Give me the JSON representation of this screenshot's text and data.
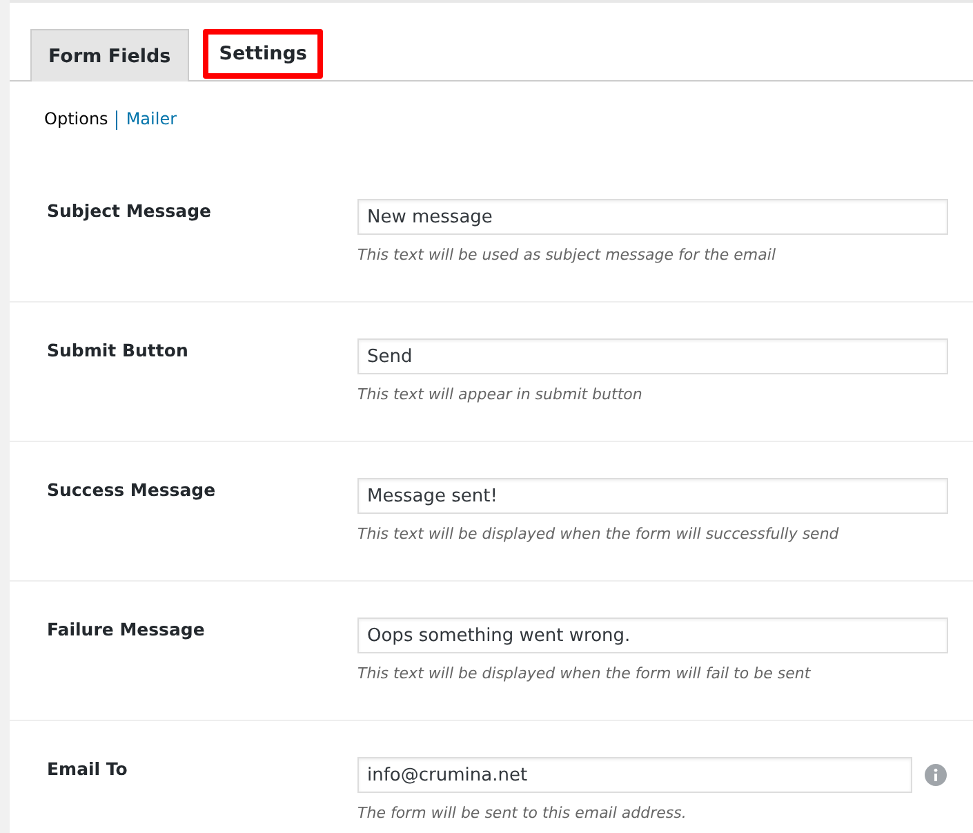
{
  "tabs": [
    {
      "label": "Form Fields",
      "selected": false,
      "highlighted": false
    },
    {
      "label": "Settings",
      "selected": true,
      "highlighted": true
    }
  ],
  "subnav": [
    {
      "label": "Options",
      "selected": true
    },
    {
      "label": "Mailer",
      "selected": false
    }
  ],
  "fields": [
    {
      "label": "Subject Message",
      "value": "New message",
      "help": "This text will be used as subject message for the email",
      "info": false
    },
    {
      "label": "Submit Button",
      "value": "Send",
      "help": "This text will appear in submit button",
      "info": false
    },
    {
      "label": "Success Message",
      "value": "Message sent!",
      "help": "This text will be displayed when the form will successfully send",
      "info": false
    },
    {
      "label": "Failure Message",
      "value": "Oops something went wrong.",
      "help": "This text will be displayed when the form will fail to be sent",
      "info": false
    },
    {
      "label": "Email To",
      "value": "info@crumina.net",
      "help": "The form will be sent to this email address.",
      "info": true
    }
  ]
}
